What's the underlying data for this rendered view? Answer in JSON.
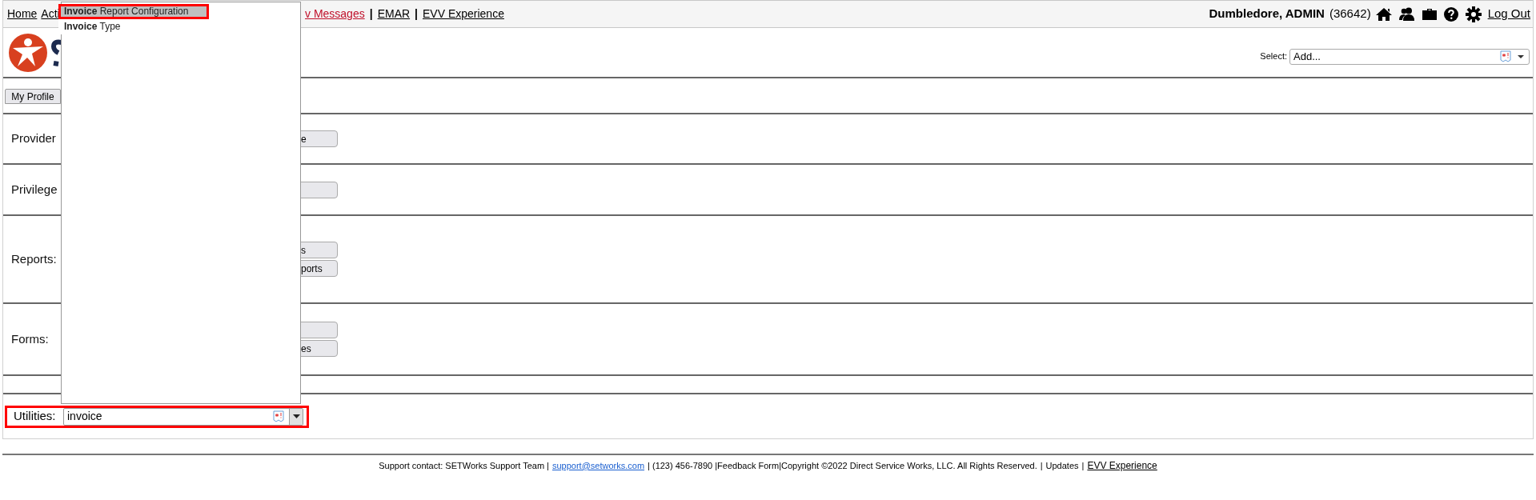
{
  "top_bar": {
    "links_start": [
      {
        "text": "Home"
      },
      {
        "text": "Acti"
      }
    ],
    "links_end": [
      {
        "text": "v Messages",
        "kind": "alert"
      },
      {
        "text": "|",
        "kind": "separator"
      },
      {
        "text": "EMAR",
        "kind": "normal"
      },
      {
        "text": "|",
        "kind": "separator"
      },
      {
        "text": "EVV Experience",
        "kind": "normal"
      }
    ],
    "user": "Dumbledore, ADMIN",
    "user_id": "(36642)",
    "logout": "Log Out"
  },
  "header": {
    "select_label": "Select:",
    "select_value": "Add..."
  },
  "profile_button": "My Profile",
  "sections": [
    {
      "label": "Provider",
      "buttons": [
        {
          "kind": "button",
          "text": "e"
        }
      ]
    },
    {
      "label": "Privilege",
      "buttons": [
        {
          "kind": "button"
        }
      ]
    },
    {
      "label": "Reports:",
      "buttons": [
        {
          "kind": "button",
          "text": "s"
        },
        {
          "kind": "button",
          "text": "ports"
        }
      ]
    },
    {
      "label": "Forms:",
      "buttons": [
        {
          "kind": "button"
        },
        {
          "kind": "button",
          "text": "es"
        }
      ]
    }
  ],
  "utilities": {
    "label": "Utilities:",
    "value": "invoice",
    "annotated": true
  },
  "suggestions": [
    {
      "text": "**Invoice** Report Configuration",
      "selected": true,
      "annotated": true
    },
    {
      "text": "**Invoice** Type",
      "selected": false,
      "annotated": false
    }
  ],
  "footer": [
    {
      "kind": "text",
      "text": "Support contact: SETWorks Support Team |"
    },
    {
      "kind": "email",
      "text": "support@setworks.com"
    },
    {
      "kind": "text",
      "text": "| (123) 456-7890 |Feedback Form|Copyright ©2022 Direct Service Works, LLC. All Rights Reserved."
    },
    {
      "kind": "text",
      "text": "|"
    },
    {
      "kind": "small",
      "text": "Updates"
    },
    {
      "kind": "text",
      "text": "|"
    },
    {
      "kind": "link",
      "text": "EVV Experience"
    }
  ]
}
